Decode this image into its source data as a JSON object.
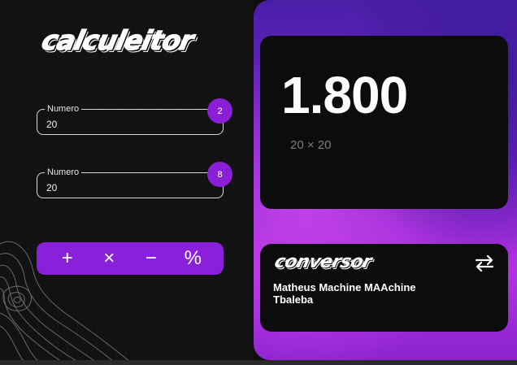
{
  "app": {
    "logo_text": "calculeitor"
  },
  "inputs": [
    {
      "label": "Numero",
      "value": "20",
      "badge": "2"
    },
    {
      "label": "Numero",
      "value": "20",
      "badge": "8"
    }
  ],
  "operations": [
    {
      "symbol": "+",
      "name": "add"
    },
    {
      "symbol": "×",
      "name": "multiply"
    },
    {
      "symbol": "−",
      "name": "subtract"
    },
    {
      "symbol": "%",
      "name": "percent"
    }
  ],
  "display": {
    "result": "1.800",
    "expression": "20 × 20"
  },
  "converter": {
    "title": "conversor",
    "text": "Matheus Machine MAAchine Tbaleba",
    "swap_icon": "swap-arrows-icon"
  },
  "colors": {
    "accent": "#8a1fdc",
    "panel_dark": "#0c0c0c",
    "background": "#121212"
  }
}
